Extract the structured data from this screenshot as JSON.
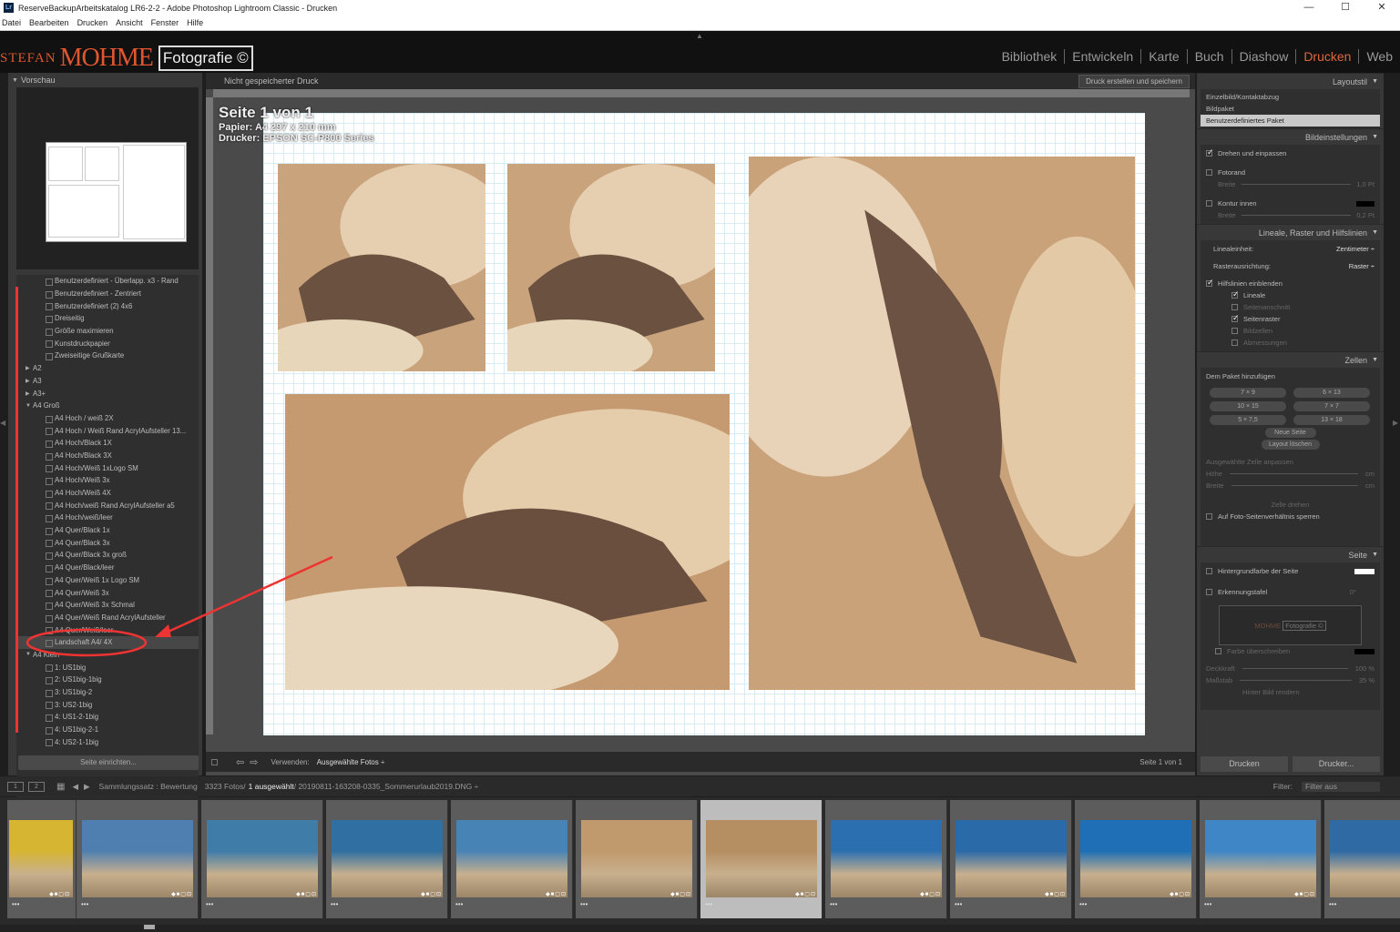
{
  "window": {
    "title": "ReserveBackupArbeitskatalog LR6-2-2 - Adobe Photoshop Lightroom Classic - Drucken",
    "controls": [
      "—",
      "☐",
      "✕"
    ]
  },
  "menu": [
    "Datei",
    "Bearbeiten",
    "Drucken",
    "Ansicht",
    "Fenster",
    "Hilfe"
  ],
  "identity": {
    "name1": "STEFAN",
    "name2": "MOHME",
    "foto": "Fotografie ©"
  },
  "modules": [
    {
      "label": "Bibliothek"
    },
    {
      "label": "Entwickeln"
    },
    {
      "label": "Karte"
    },
    {
      "label": "Buch"
    },
    {
      "label": "Diashow"
    },
    {
      "label": "Drucken",
      "active": true
    },
    {
      "label": "Web"
    }
  ],
  "left": {
    "preview_title": "Vorschau",
    "template_rows": [
      {
        "t": "Benutzerdefiniert - Überlapp. x3 - Rand",
        "k": "item"
      },
      {
        "t": "Benutzerdefiniert - Zentriert",
        "k": "item"
      },
      {
        "t": "Benutzerdefiniert (2) 4x6",
        "k": "item"
      },
      {
        "t": "Dreiseitig",
        "k": "item"
      },
      {
        "t": "Größe maximieren",
        "k": "item"
      },
      {
        "t": "Kunstdruckpapier",
        "k": "item"
      },
      {
        "t": "Zweiseitige Grußkarte",
        "k": "item"
      },
      {
        "t": "A2",
        "k": "folder",
        "open": false
      },
      {
        "t": "A3",
        "k": "folder",
        "open": false
      },
      {
        "t": "A3+",
        "k": "folder",
        "open": false
      },
      {
        "t": "A4 Groß",
        "k": "folder",
        "open": true
      },
      {
        "t": "A4 Hoch / weiß 2X",
        "k": "item"
      },
      {
        "t": "A4 Hoch / Weiß Rand AcrylAufsteller 13...",
        "k": "item"
      },
      {
        "t": "A4 Hoch/Black 1X",
        "k": "item"
      },
      {
        "t": "A4 Hoch/Black 3X",
        "k": "item"
      },
      {
        "t": "A4 Hoch/Weiß 1xLogo SM",
        "k": "item"
      },
      {
        "t": "A4 Hoch/Weiß 3x",
        "k": "item"
      },
      {
        "t": "A4 Hoch/Weiß 4X",
        "k": "item"
      },
      {
        "t": "A4 Hoch/weiß Rand AcrylAufsteller a5",
        "k": "item"
      },
      {
        "t": "A4 Hoch/weiß/leer",
        "k": "item"
      },
      {
        "t": "A4 Quer/Black 1x",
        "k": "item"
      },
      {
        "t": "A4 Quer/Black 3x",
        "k": "item"
      },
      {
        "t": "A4 Quer/Black 3x groß",
        "k": "item"
      },
      {
        "t": "A4 Quer/Black/leer",
        "k": "item"
      },
      {
        "t": "A4 Quer/Weiß 1x Logo SM",
        "k": "item"
      },
      {
        "t": "A4 Quer/Weiß 3x",
        "k": "item"
      },
      {
        "t": "A4 Quer/Weiß 3x Schmal",
        "k": "item"
      },
      {
        "t": "A4 Quer/Weiß Rand AcrylAufsteller",
        "k": "item"
      },
      {
        "t": "A4 Quer/Weiß/leer",
        "k": "item"
      },
      {
        "t": "Landschaft A4/ 4X",
        "k": "item",
        "sel": true
      },
      {
        "t": "A4 Klein",
        "k": "folder",
        "open": true
      },
      {
        "t": "1: US1big",
        "k": "item"
      },
      {
        "t": "2: US1big-1big",
        "k": "item"
      },
      {
        "t": "3: US1big-2",
        "k": "item"
      },
      {
        "t": "3: US2-1big",
        "k": "item"
      },
      {
        "t": "4: US1-2-1big",
        "k": "item"
      },
      {
        "t": "4: US1big-2-1",
        "k": "item"
      },
      {
        "t": "4: US2-1-1big",
        "k": "item"
      }
    ],
    "page_setup": "Seite einrichten..."
  },
  "center": {
    "title": "Nicht gespeicherter Druck",
    "action": "Druck erstellen und speichern",
    "page_title": "Seite 1 von 1",
    "paper": "Papier:  A4 297 x 210 mm",
    "printer": "Drucker:  EPSON SC-P800 Series",
    "use_label": "Verwenden:",
    "use_value": "Ausgewählte Fotos ÷",
    "page_count": "Seite 1 von 1"
  },
  "right": {
    "layoutstil": "Layoutstil",
    "styles": [
      "Einzelbild/Kontaktabzug",
      "Bildpaket",
      "Benutzerdefiniertes Paket"
    ],
    "bildeinstellungen": "Bildeinstellungen",
    "drehen": "Drehen und einpassen",
    "fotorand": "Fotorand",
    "breite": "Breite",
    "breite_val": "1,0 Pt",
    "kontur": "Kontur innen",
    "breite_val2": "0,2 Pt",
    "lineale_title": "Lineale, Raster und Hilfslinien",
    "linealeinheit": "Linealeinheit:",
    "linealeinheit_val": "Zentimeter ÷",
    "rasterausrichtung": "Rasterausrichtung:",
    "raster_val": "Raster ÷",
    "hilfslinien": "Hilfslinien einblenden",
    "sub": [
      {
        "t": "Lineale",
        "on": true
      },
      {
        "t": "Seitenanschnitt",
        "on": false
      },
      {
        "t": "Seitenraster",
        "on": true
      },
      {
        "t": "Bildzellen",
        "on": false
      },
      {
        "t": "Abmessungen",
        "on": false
      }
    ],
    "zellen": "Zellen",
    "paket": "Dem Paket hinzufügen",
    "cells": [
      "7 × 9",
      "6 × 13",
      "10 × 15",
      "7 × 7",
      "5 × 7,5",
      "13 × 18"
    ],
    "neue_seite": "Neue Seite",
    "layout_loeschen": "Layout löschen",
    "zelle_anpassen": "Ausgewählte Zelle anpassen",
    "hoehe": "Höhe",
    "breite2": "Breite",
    "cm": "cm",
    "zelle_drehen": "Zelle drehen",
    "seitenverh": "Auf Foto-Seitenverhältnis sperren",
    "seite": "Seite",
    "hintergrund": "Hintergrundfarbe der Seite",
    "erkennungstafel": "Erkennungstafel",
    "angle": "0°",
    "farbe": "Farbe überschreiben",
    "deckkraft": "Deckkraft",
    "deckkraft_val": "100 %",
    "massstab": "Maßstab",
    "massstab_val": "35 %",
    "hinter": "Hinter Bild rendern",
    "drucken": "Drucken",
    "drucker": "Drucker..."
  },
  "filmbar": {
    "p1": "1",
    "p2": "2",
    "path": "Sammlungssatz : Bewertung",
    "count": "3323 Fotos/",
    "sel": "1 ausgewählt",
    "file": "/ 20190811-163208-0335_Sommerurlaub2019.DNG ÷",
    "filter_label": "Filter:",
    "filter_val": "Filter aus"
  },
  "film": [
    {
      "c": "#d6b533"
    },
    {
      "c": "#4f7fb0"
    },
    {
      "c": "#3f7ca8"
    },
    {
      "c": "#2f6fa1"
    },
    {
      "c": "#4883b5"
    },
    {
      "c": "#c09a6c"
    },
    {
      "c": "#b58e62",
      "sel": true
    },
    {
      "c": "#2c6fb0"
    },
    {
      "c": "#2a6aa8"
    },
    {
      "c": "#1e6fb5"
    },
    {
      "c": "#3e86c6"
    },
    {
      "c": "#2f6aa5"
    }
  ],
  "film_stars": "•••",
  "film_badge": "◆■▢⊡"
}
